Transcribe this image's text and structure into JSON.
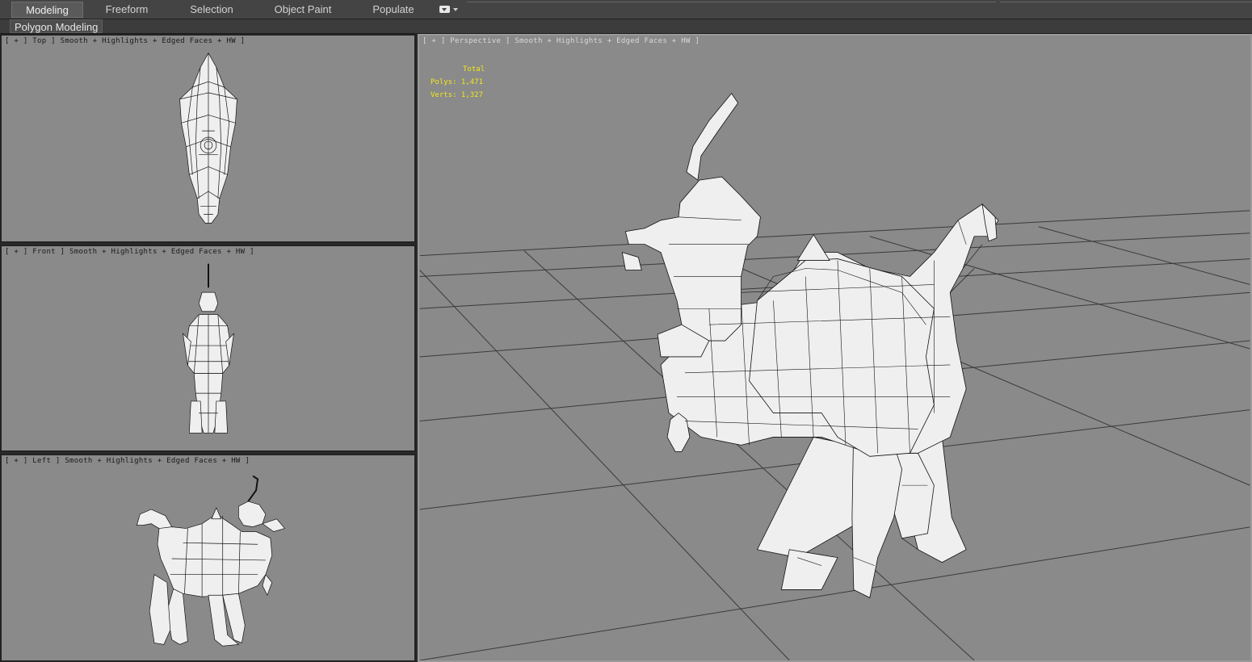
{
  "ribbon": {
    "tabs": [
      {
        "label": "Modeling",
        "active": true
      },
      {
        "label": "Freeform",
        "active": false
      },
      {
        "label": "Selection",
        "active": false
      },
      {
        "label": "Object Paint",
        "active": false
      },
      {
        "label": "Populate",
        "active": false
      }
    ],
    "options_icon": "dropdown-icon"
  },
  "panel": {
    "label": "Polygon Modeling"
  },
  "viewports": {
    "top": {
      "label": "[ + ] Top ] Smooth + Highlights + Edged Faces + HW ]"
    },
    "front": {
      "label": "[ + ] Front ] Smooth + Highlights + Edged Faces + HW ]"
    },
    "left": {
      "label": "[ + ] Left ] Smooth + Highlights + Edged Faces + HW ]"
    },
    "perspective": {
      "label": "[ + ] Perspective ] Smooth + Highlights + Edged Faces + HW ]"
    }
  },
  "stats": {
    "total_label": "Total",
    "polys": "Polys: 1,471",
    "verts": "Verts: 1,327",
    "color": "#f2e61a"
  },
  "colors": {
    "viewport_bg": "#8a8a8a",
    "ribbon_bg": "#444444",
    "mesh_fill": "#f0f0f0",
    "wire": "#111111"
  }
}
